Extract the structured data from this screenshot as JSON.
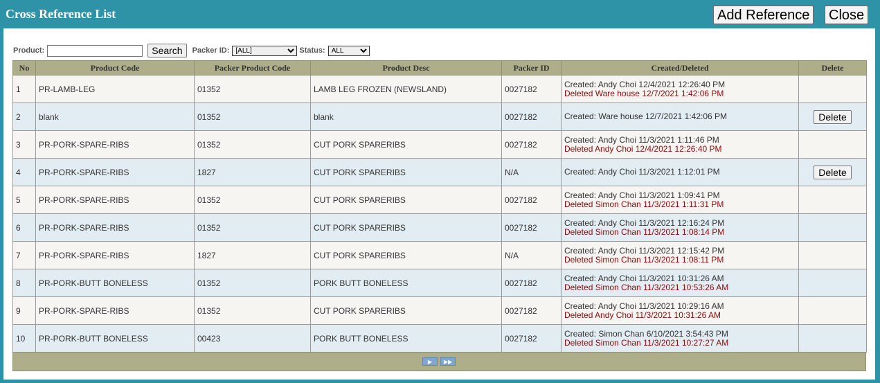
{
  "header": {
    "title": "Cross Reference List",
    "add_reference_label": "Add Reference",
    "close_label": "Close"
  },
  "filters": {
    "product_label": "Product:",
    "product_value": "",
    "search_label": "Search",
    "packer_id_label": "Packer ID:",
    "packer_id_selected": "[ALL]",
    "status_label": "Status:",
    "status_selected": "ALL"
  },
  "table": {
    "columns": [
      "No",
      "Product Code",
      "Packer Product Code",
      "Product Desc",
      "Packer ID",
      "Created/Deleted",
      "Delete"
    ],
    "rows": [
      {
        "no": "1",
        "product_code": "PR-LAMB-LEG",
        "packer_product_code": "01352",
        "product_desc": "LAMB LEG FROZEN (NEWSLAND)",
        "packer_id": "0027182",
        "created": "Created: Andy Choi  12/4/2021 12:26:40 PM",
        "deleted": "Deleted Ware house  12/7/2021 1:42:06 PM",
        "delete_label": ""
      },
      {
        "no": "2",
        "product_code": "blank",
        "packer_product_code": "01352",
        "product_desc": "blank",
        "packer_id": "0027182",
        "created": "Created: Ware house  12/7/2021 1:42:06 PM",
        "deleted": "",
        "delete_label": "Delete"
      },
      {
        "no": "3",
        "product_code": "PR-PORK-SPARE-RIBS",
        "packer_product_code": "01352",
        "product_desc": "CUT PORK SPARERIBS",
        "packer_id": "0027182",
        "created": "Created: Andy Choi  11/3/2021 1:11:46 PM",
        "deleted": "Deleted Andy Choi  12/4/2021 12:26:40 PM",
        "delete_label": ""
      },
      {
        "no": "4",
        "product_code": "PR-PORK-SPARE-RIBS",
        "packer_product_code": "1827",
        "product_desc": "CUT PORK SPARERIBS",
        "packer_id": "N/A",
        "created": "Created: Andy Choi  11/3/2021 1:12:01 PM",
        "deleted": "",
        "delete_label": "Delete"
      },
      {
        "no": "5",
        "product_code": "PR-PORK-SPARE-RIBS",
        "packer_product_code": "01352",
        "product_desc": "CUT PORK SPARERIBS",
        "packer_id": "0027182",
        "created": "Created: Andy Choi  11/3/2021 1:09:41 PM",
        "deleted": "Deleted Simon Chan  11/3/2021 1:11:31 PM",
        "delete_label": ""
      },
      {
        "no": "6",
        "product_code": "PR-PORK-SPARE-RIBS",
        "packer_product_code": "01352",
        "product_desc": "CUT PORK SPARERIBS",
        "packer_id": "0027182",
        "created": "Created: Andy Choi  11/3/2021 12:16:24 PM",
        "deleted": "Deleted Simon Chan  11/3/2021 1:08:14 PM",
        "delete_label": ""
      },
      {
        "no": "7",
        "product_code": "PR-PORK-SPARE-RIBS",
        "packer_product_code": "1827",
        "product_desc": "CUT PORK SPARERIBS",
        "packer_id": "N/A",
        "created": "Created: Andy Choi  11/3/2021 12:15:42 PM",
        "deleted": "Deleted Simon Chan  11/3/2021 1:08:11 PM",
        "delete_label": ""
      },
      {
        "no": "8",
        "product_code": "PR-PORK-BUTT BONELESS",
        "packer_product_code": "01352",
        "product_desc": "PORK BUTT BONELESS",
        "packer_id": "0027182",
        "created": "Created: Andy Choi  11/3/2021 10:31:26 AM",
        "deleted": "Deleted Simon Chan  11/3/2021 10:53:26 AM",
        "delete_label": ""
      },
      {
        "no": "9",
        "product_code": "PR-PORK-SPARE-RIBS",
        "packer_product_code": "01352",
        "product_desc": "CUT PORK SPARERIBS",
        "packer_id": "0027182",
        "created": "Created: Andy Choi  11/3/2021 10:29:16 AM",
        "deleted": "Deleted Andy Choi  11/3/2021 10:31:26 AM",
        "delete_label": ""
      },
      {
        "no": "10",
        "product_code": "PR-PORK-BUTT BONELESS",
        "packer_product_code": "00423",
        "product_desc": "PORK BUTT BONELESS",
        "packer_id": "0027182",
        "created": "Created: Simon Chan  6/10/2021 3:54:43 PM",
        "deleted": "Deleted Simon Chan  11/3/2021 10:27:27 AM",
        "delete_label": ""
      }
    ]
  },
  "pagination": {
    "next_icon": "next-page-icon",
    "last_icon": "last-page-icon",
    "next_glyph": "▶",
    "last_glyph": "▶▶"
  },
  "colors": {
    "frame": "#2e93a6",
    "header_row": "#aeae8a",
    "row_odd": "#f6f5f1",
    "row_even": "#e2ecf3",
    "deleted_text": "#8b0a0a"
  }
}
